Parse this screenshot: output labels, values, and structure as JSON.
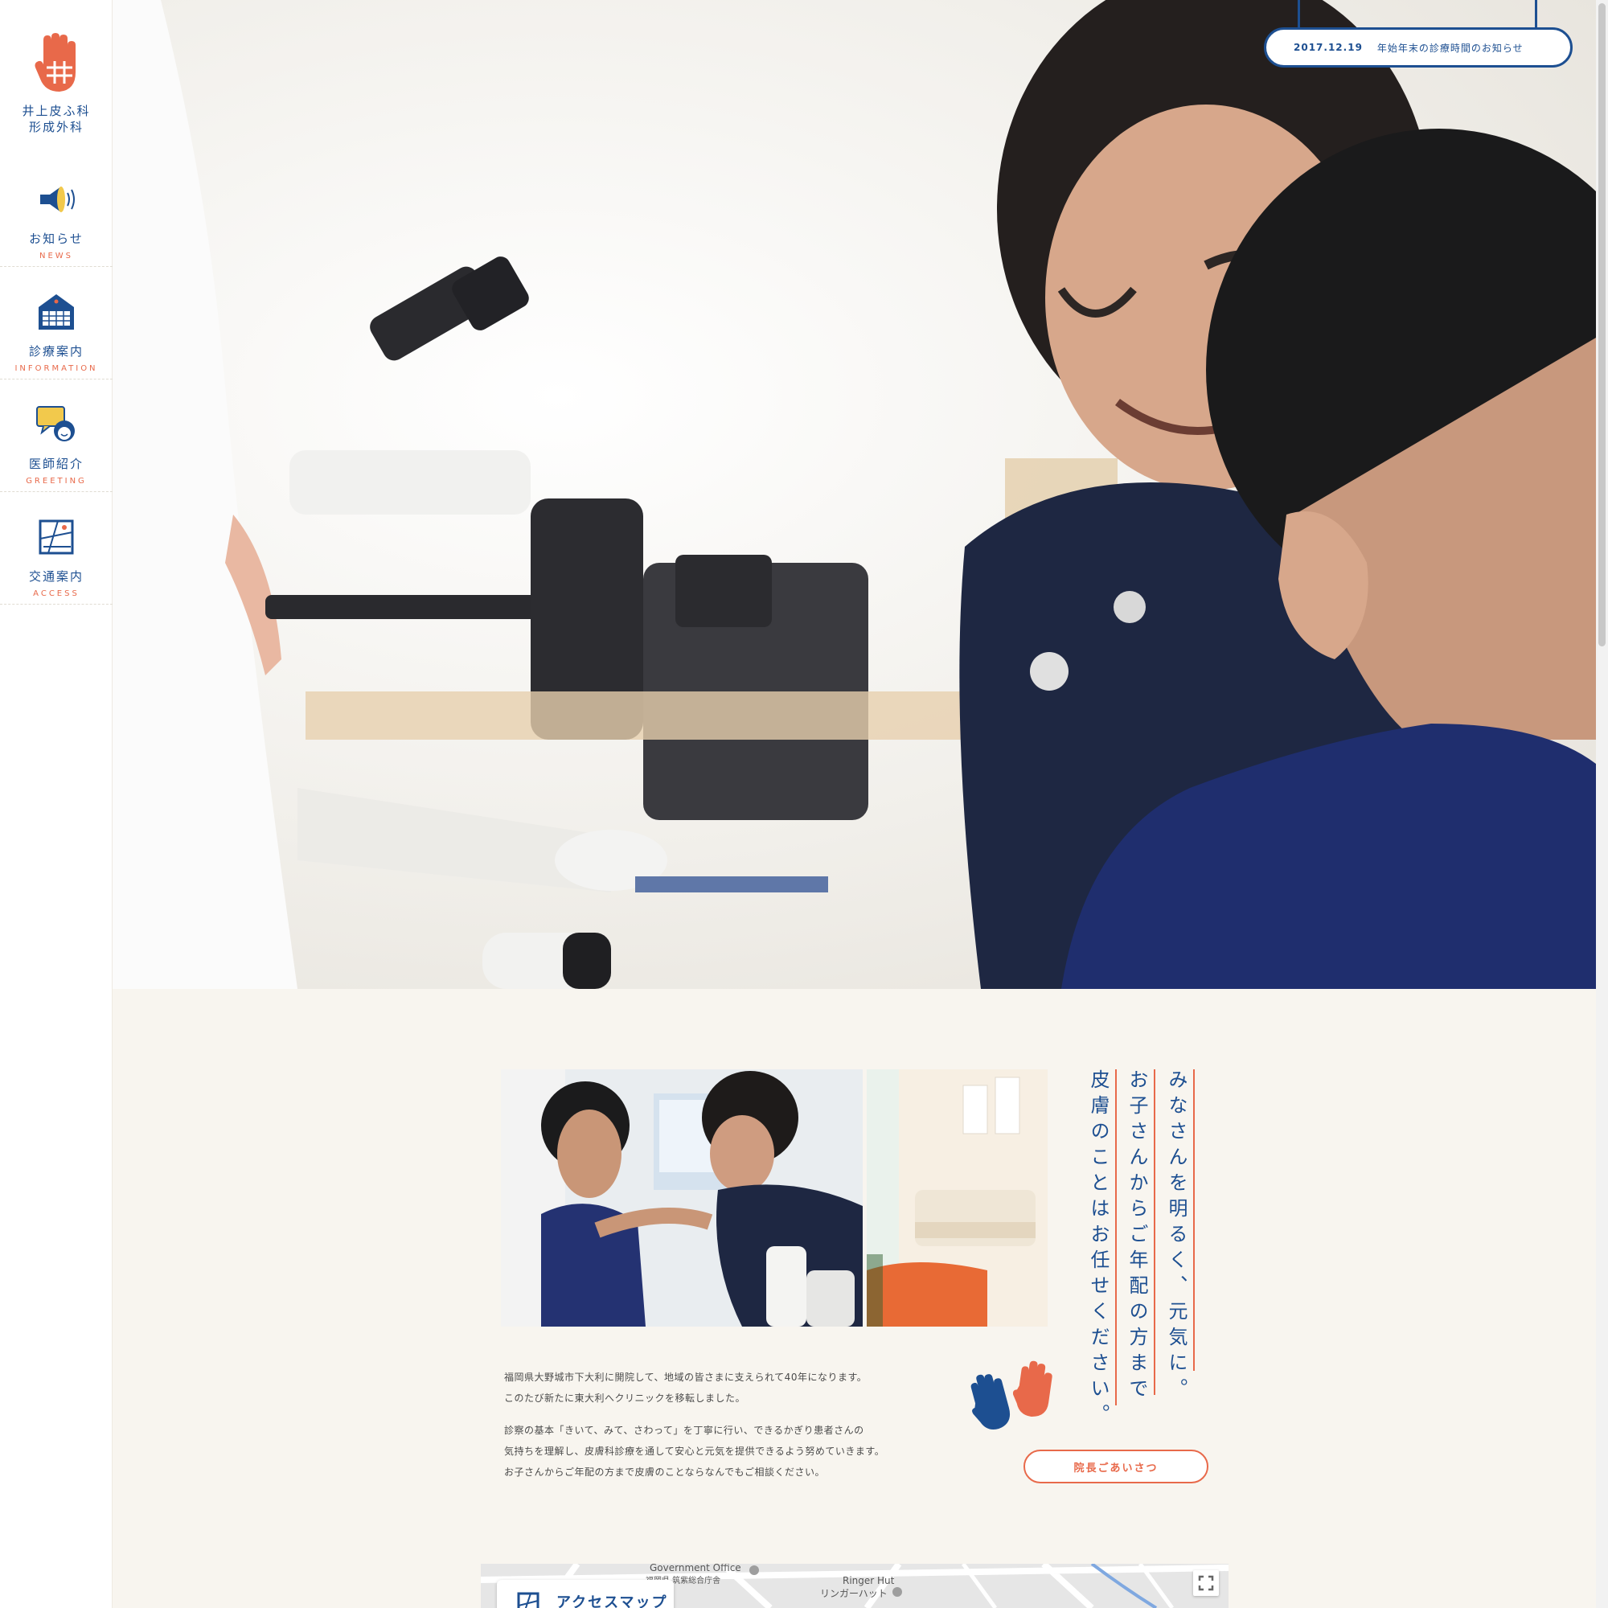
{
  "logo": {
    "text": "井上皮ふ科\n形成外科"
  },
  "nav": [
    {
      "jp": "お知らせ",
      "en": "NEWS",
      "icon": "megaphone-icon"
    },
    {
      "jp": "診療案内",
      "en": "INFORMATION",
      "icon": "calendar-icon"
    },
    {
      "jp": "医師紹介",
      "en": "GREETING",
      "icon": "doctor-speech-icon"
    },
    {
      "jp": "交通案内",
      "en": "ACCESS",
      "icon": "map-icon"
    }
  ],
  "news": {
    "date": "2017.12.19",
    "title": "年始年末の診療時間のお知らせ"
  },
  "tagline": [
    "みなさんを明るく、元気に。",
    "お子さんからご年配の方まで",
    "皮膚のことはお任せください。"
  ],
  "intro": {
    "p1": "福岡県大野城市下大利に開院して、地域の皆さまに支えられて40年になります。\nこのたび新たに東大利へクリニックを移転しました。",
    "p2": "診察の基本「きいて、みて、さわって」を丁寧に行い、できるかぎり患者さんの\n気持ちを理解し、皮膚科診療を通して安心と元気を提供できるよう努めていきます。\nお子さんからご年配の方まで皮膚のことならなんでもご相談ください。"
  },
  "greeting_button": "院長ごあいさつ",
  "map": {
    "card_title": "アクセスマップ",
    "labels": [
      "Government Office",
      "福岡県 筑紫総合庁舎",
      "Ringer Hut",
      "リンガーハット"
    ]
  },
  "colors": {
    "primary": "#1d4f91",
    "accent": "#e8694a",
    "background": "#f8f5ef"
  }
}
